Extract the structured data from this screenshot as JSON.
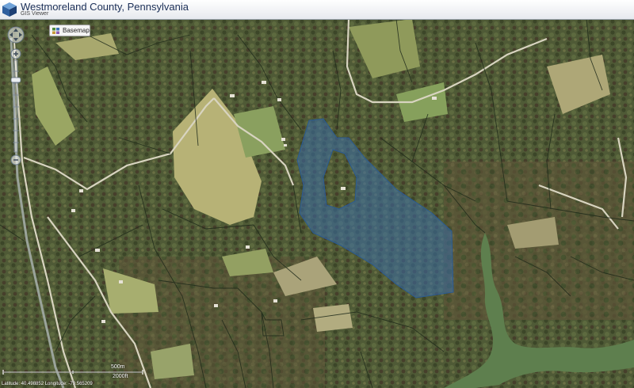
{
  "header": {
    "title": "Westmoreland County, Pennsylvania",
    "subtitle": "GIS Viewer",
    "logo_icon": "cube-logo-icon"
  },
  "toolbar": {
    "basemap_label": "Basemap",
    "basemap_icon": "basemap-grid-icon"
  },
  "navigation": {
    "pan_icon": "pan-arrows-icon",
    "zoom_in_icon": "zoom-in-icon",
    "zoom_out_icon": "zoom-out-icon"
  },
  "map": {
    "imagery": "aerial",
    "parcel_highlight_color": "#3a6ea8",
    "parcel_line_color": "#1f2a1a",
    "water_color": "#5e7f4e"
  },
  "scale": {
    "metric_label": "500m",
    "imperial_label": "2000ft"
  },
  "status": {
    "coordinates": "Latitude: 40.498852 Longitude: -79.565209"
  }
}
